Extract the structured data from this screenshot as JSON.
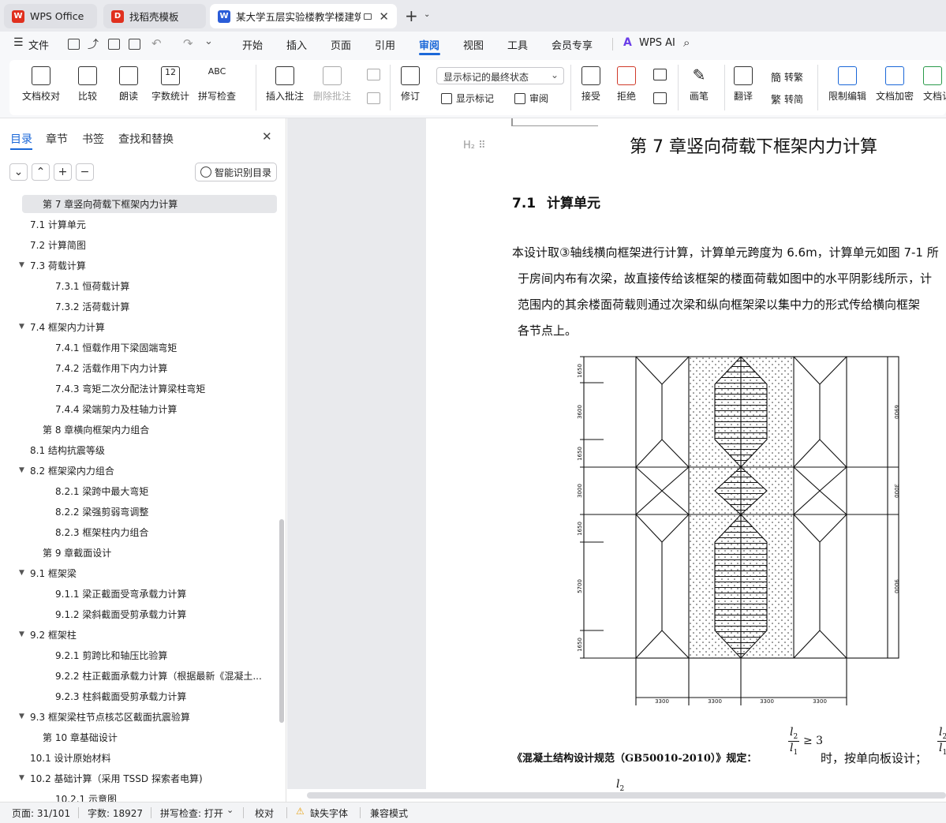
{
  "tabs": [
    {
      "label": "WPS Office",
      "logo": "W",
      "color": "#e0301e"
    },
    {
      "label": "找稻壳模板",
      "logo": "D",
      "color": "#e0301e"
    },
    {
      "label": "某大学五层实验楼教学楼建筑",
      "logo": "W",
      "color": "#2a5cd8"
    }
  ],
  "menu": {
    "file": "文件",
    "items": [
      "开始",
      "插入",
      "页面",
      "引用",
      "审阅",
      "视图",
      "工具",
      "会员专享"
    ],
    "active": "审阅",
    "ai": "WPS AI"
  },
  "ribbon": {
    "doc_check": "文档校对",
    "compare": "比较",
    "read_aloud": "朗读",
    "word_count": "字数统计",
    "spell_check": "拼写检查",
    "insert_comment": "插入批注",
    "delete_comment": "删除批注",
    "track": "修订",
    "markup_state": "显示标记的最终状态",
    "show_markup": "显示标记",
    "review": "审阅",
    "accept": "接受",
    "reject": "拒绝",
    "ink": "画笔",
    "translate": "翻译",
    "to_simplified": "转繁",
    "to_traditional": "转简",
    "restrict": "限制编辑",
    "encrypt": "文档加密",
    "doc_more": "文档认"
  },
  "sidebar": {
    "tabs": [
      "目录",
      "章节",
      "书签",
      "查找和替换"
    ],
    "smart_toc": "智能识别目录",
    "toc": [
      {
        "t": "第 7 章竖向荷载下框架内力计算",
        "lv": 0,
        "sel": true
      },
      {
        "t": "7.1  计算单元",
        "lv": 1
      },
      {
        "t": "7.2  计算简图",
        "lv": 1
      },
      {
        "t": "7.3  荷载计算",
        "lv": 1,
        "exp": true
      },
      {
        "t": "7.3.1  恒荷载计算",
        "lv": 2
      },
      {
        "t": "7.3.2  活荷载计算",
        "lv": 2
      },
      {
        "t": "7.4  框架内力计算",
        "lv": 1,
        "exp": true
      },
      {
        "t": "7.4.1  恒载作用下梁固端弯矩",
        "lv": 2
      },
      {
        "t": "7.4.2  活载作用下内力计算",
        "lv": 2
      },
      {
        "t": "7.4.3  弯矩二次分配法计算梁柱弯矩",
        "lv": 2
      },
      {
        "t": "7.4.4  梁端剪力及柱轴力计算",
        "lv": 2
      },
      {
        "t": "第 8 章横向框架内力组合",
        "lv": 0
      },
      {
        "t": "8.1  结构抗震等级",
        "lv": 1
      },
      {
        "t": "8.2  框架梁内力组合",
        "lv": 1,
        "exp": true
      },
      {
        "t": "8.2.1  梁跨中最大弯矩",
        "lv": 2
      },
      {
        "t": "8.2.2  梁强剪弱弯调整",
        "lv": 2
      },
      {
        "t": "8.2.3  框架柱内力组合",
        "lv": 2
      },
      {
        "t": "第 9 章截面设计",
        "lv": 0
      },
      {
        "t": "9.1  框架梁",
        "lv": 1,
        "exp": true
      },
      {
        "t": "9.1.1  梁正截面受弯承载力计算",
        "lv": 2
      },
      {
        "t": "9.1.2  梁斜截面受剪承载力计算",
        "lv": 2
      },
      {
        "t": "9.2  框架柱",
        "lv": 1,
        "exp": true
      },
      {
        "t": "9.2.1  剪跨比和轴压比验算",
        "lv": 2
      },
      {
        "t": "9.2.2  柱正截面承载力计算（根据最新《混凝土...",
        "lv": 2
      },
      {
        "t": "9.2.3  柱斜截面受剪承载力计算",
        "lv": 2
      },
      {
        "t": "9.3  框架梁柱节点核芯区截面抗震验算",
        "lv": 1,
        "exp": true
      },
      {
        "t": "第 10 章基础设计",
        "lv": 0
      },
      {
        "t": "10.1  设计原始材料",
        "lv": 1
      },
      {
        "t": "10.2  基础计算（采用 TSSD 探索者电算)",
        "lv": 1,
        "exp": true
      },
      {
        "t": "10.2.1  示意图",
        "lv": 2
      }
    ]
  },
  "doc": {
    "chapter_title": "第 7 章竖向荷载下框架内力计算",
    "section_num": "7.1",
    "section_title": "计算单元",
    "lines": [
      "本设计取③轴线横向框架进行计算，计算单元跨度为 6.6m，计算单元如图 7-1 所",
      "于房间内布有次梁，故直接传给该框架的楼面荷载如图中的水平阴影线所示，计",
      "范围内的其余楼面荷载则通过次梁和纵向框架梁以集中力的形式传给横向框架",
      "各节点上。"
    ],
    "code_text": "《混凝土结构设计规范（GB50010-2010）》规定：",
    "f_num": "l",
    "f_sub_top": "2",
    "f_den": "l",
    "f_sub_bot": "1",
    "f_ineq": "≥ 3",
    "after_formula": "时，按单向板设计；",
    "dims_left": [
      "1650",
      "3600",
      "1650",
      "3000",
      "1650",
      "5700",
      "1650"
    ],
    "dims_right": [
      "6900",
      "3000",
      "9000"
    ],
    "dims_bottom": [
      "3300",
      "3300",
      "3300",
      "3300"
    ]
  },
  "status": {
    "page": "页面: 31/101",
    "words": "字数: 18927",
    "spell": "拼写检查: 打开",
    "proof": "校对",
    "missing_font": "缺失字体",
    "compat": "兼容模式"
  }
}
